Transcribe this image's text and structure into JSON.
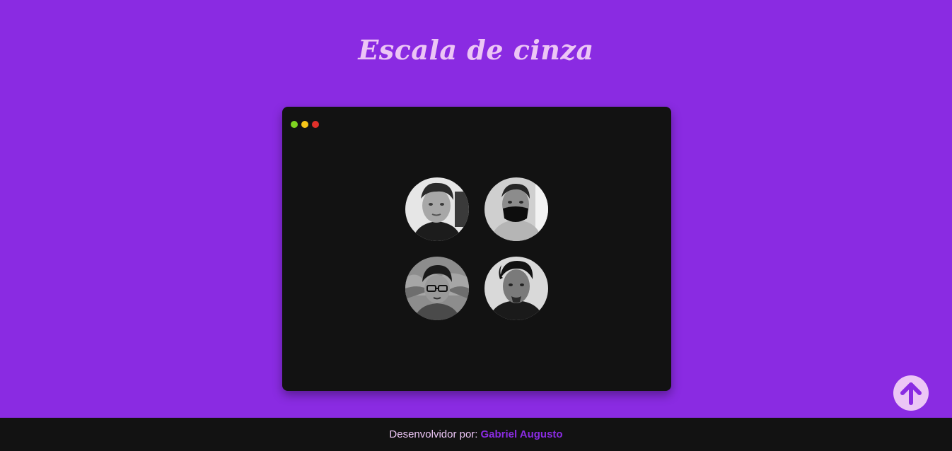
{
  "page": {
    "title": "Escala de cinza"
  },
  "window": {
    "controls": [
      {
        "name": "window-dot-green",
        "color": "#7ed321"
      },
      {
        "name": "window-dot-yellow",
        "color": "#f5c518"
      },
      {
        "name": "window-dot-red",
        "color": "#e0302a"
      }
    ]
  },
  "gallery": {
    "photos": [
      {
        "name": "photo-man-hair",
        "icon": "portrait-icon"
      },
      {
        "name": "photo-man-mask",
        "icon": "portrait-icon"
      },
      {
        "name": "photo-cartoon-avatar",
        "icon": "portrait-icon"
      },
      {
        "name": "photo-man-dark-hair",
        "icon": "portrait-icon"
      }
    ]
  },
  "scroll_top": {
    "icon": "arrow-up-icon"
  },
  "footer": {
    "prefix": "Desenvolvidor por:",
    "author": "Gabriel Augusto"
  },
  "colors": {
    "background": "#8a2be2",
    "accent": "#ecc6f5",
    "window": "#121212"
  }
}
